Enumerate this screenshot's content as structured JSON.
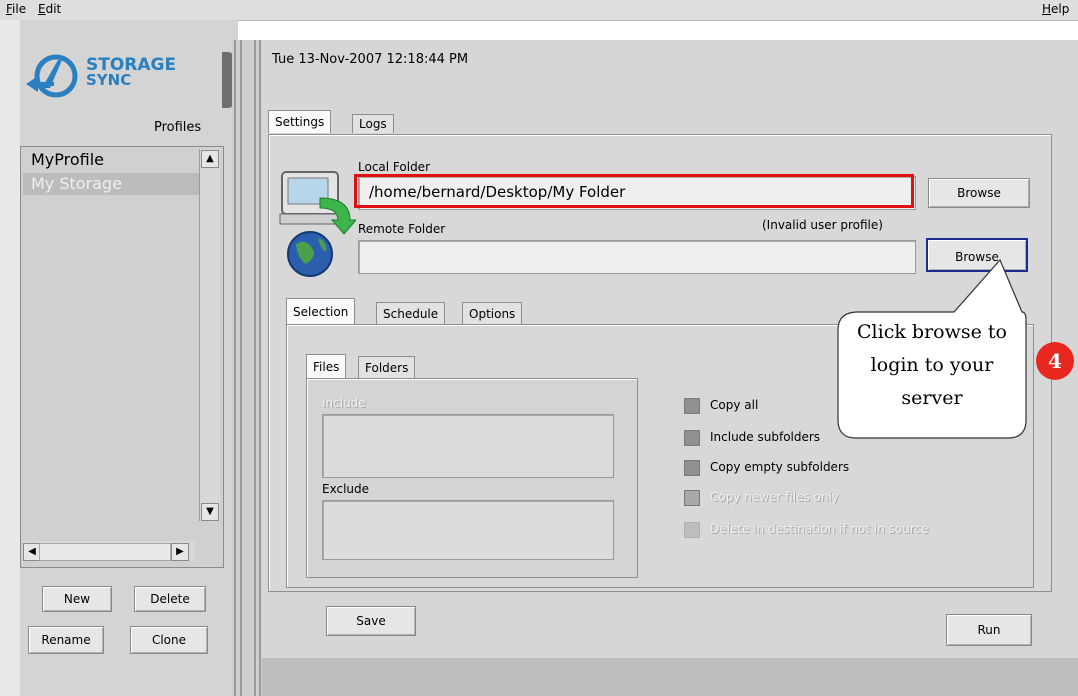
{
  "menu": {
    "file": "File",
    "file_key": "F",
    "file_rest": "ile",
    "edit": "Edit",
    "edit_key": "E",
    "edit_rest": "dit",
    "help": "Help",
    "help_key": "H",
    "help_rest": "elp"
  },
  "brand": {
    "line1": "STORAGE",
    "line2": "SYNC",
    "accent": "#2a7fc0"
  },
  "profiles": {
    "header": "Profiles",
    "items": [
      "MyProfile",
      "My Storage"
    ]
  },
  "left_buttons": {
    "new": "New",
    "delete": "Delete",
    "rename": "Rename",
    "clone": "Clone"
  },
  "timestamp": "Tue 13-Nov-2007 12:18:44 PM",
  "main_tabs": {
    "settings": "Settings",
    "logs": "Logs"
  },
  "local_folder": {
    "label": "Local Folder",
    "value": "/home/bernard/Desktop/My Folder",
    "browse": "Browse"
  },
  "remote_folder": {
    "label": "Remote Folder",
    "status": "(Invalid user profile)",
    "value": "",
    "browse": "Browse"
  },
  "sub_tabs": {
    "selection": "Selection",
    "schedule": "Schedule",
    "options": "Options"
  },
  "files_tabs": {
    "files": "Files",
    "folders": "Folders"
  },
  "include_label": "Include",
  "exclude_label": "Exclude",
  "checkboxes": [
    {
      "label": "Copy all",
      "enabled": true
    },
    {
      "label": "Include subfolders",
      "enabled": true
    },
    {
      "label": "Copy empty subfolders",
      "enabled": true
    },
    {
      "label": "Copy newer files only",
      "enabled": false
    },
    {
      "label": "Delete in destination if not in source",
      "enabled": false
    }
  ],
  "actions": {
    "save": "Save",
    "run": "Run"
  },
  "callout": {
    "line1": "Click browse to",
    "line2": "login to your",
    "line3": "server",
    "step": "4",
    "step_color": "#e8281e",
    "highlight_color": "#e01010"
  }
}
